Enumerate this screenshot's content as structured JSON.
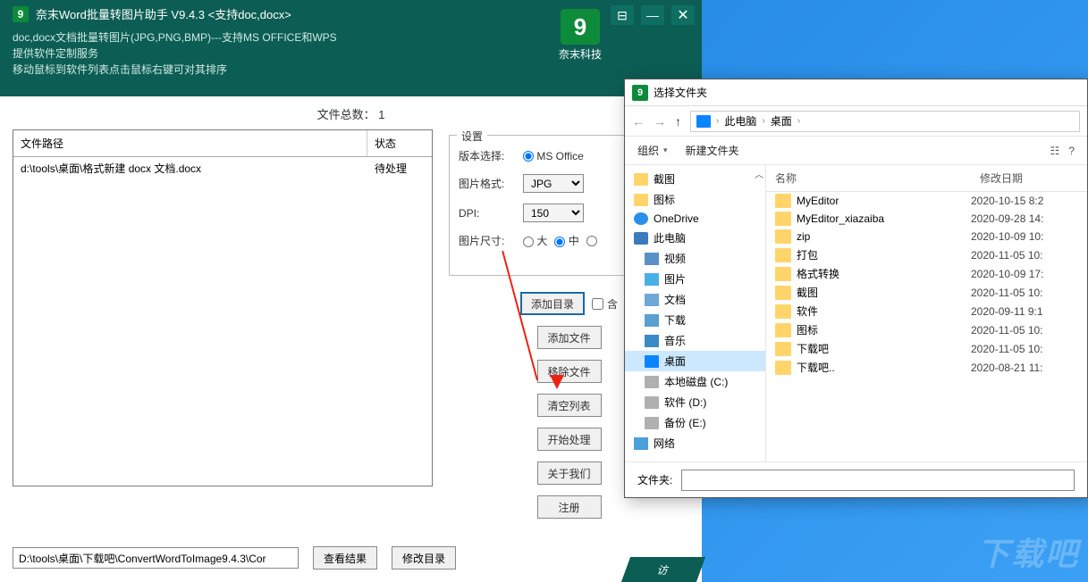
{
  "app": {
    "title": "奈末Word批量转图片助手    V9.4.3   <支持doc,docx>",
    "desc1": "doc,docx文档批量转图片(JPG,PNG,BMP)---支持MS OFFICE和WPS",
    "desc2": "提供软件定制服务",
    "desc3": "移动鼠标到软件列表点击鼠标右键可对其排序",
    "brand": "奈末科技",
    "file_total_label": "文件总数：",
    "file_total": "1",
    "columns": {
      "path": "文件路径",
      "status": "状态"
    },
    "rows": [
      {
        "path": "d:\\tools\\桌面\\格式新建 docx 文档.docx",
        "status": "待处理"
      }
    ],
    "settings": {
      "legend": "设置",
      "version_label": "版本选择:",
      "version_option": "MS Office",
      "format_label": "图片格式:",
      "format_value": "JPG",
      "dpi_label": "DPI:",
      "dpi_value": "150",
      "size_label": "图片尺寸:",
      "size_big": "大",
      "size_mid": "中",
      "include_check": "含"
    },
    "buttons": {
      "add_dir": "添加目录",
      "add_file": "添加文件",
      "remove_file": "移除文件",
      "clear_list": "清空列表",
      "start": "开始处理",
      "about": "关于我们",
      "register": "注册",
      "view_result": "查看结果",
      "change_dir": "修改目录"
    },
    "output_path": "D:\\tools\\桌面\\下载吧\\ConvertWordToImage9.4.3\\Cor",
    "tab_peek": "访"
  },
  "dialog": {
    "title": "选择文件夹",
    "breadcrumb": {
      "pc": "此电脑",
      "desktop": "桌面"
    },
    "toolbar": {
      "organize": "组织",
      "new_folder": "新建文件夹"
    },
    "tree": [
      {
        "label": "截图",
        "icon": "ico-folder",
        "lvl": "l0"
      },
      {
        "label": "图标",
        "icon": "ico-folder",
        "lvl": "l0"
      },
      {
        "label": "OneDrive",
        "icon": "ico-cloud",
        "lvl": "l0"
      },
      {
        "label": "此电脑",
        "icon": "ico-monitor",
        "lvl": "l0"
      },
      {
        "label": "视频",
        "icon": "ico-video",
        "lvl": ""
      },
      {
        "label": "图片",
        "icon": "ico-pic",
        "lvl": ""
      },
      {
        "label": "文档",
        "icon": "ico-doc",
        "lvl": ""
      },
      {
        "label": "下载",
        "icon": "ico-dl",
        "lvl": ""
      },
      {
        "label": "音乐",
        "icon": "ico-music",
        "lvl": ""
      },
      {
        "label": "桌面",
        "icon": "ico-blue",
        "lvl": "",
        "selected": true
      },
      {
        "label": "本地磁盘 (C:)",
        "icon": "ico-drive",
        "lvl": ""
      },
      {
        "label": "软件 (D:)",
        "icon": "ico-drive",
        "lvl": ""
      },
      {
        "label": "备份 (E:)",
        "icon": "ico-drive",
        "lvl": ""
      },
      {
        "label": "网络",
        "icon": "ico-net",
        "lvl": "l0"
      }
    ],
    "list_head": {
      "name": "名称",
      "date": "修改日期"
    },
    "list": [
      {
        "name": "MyEditor",
        "date": "2020-10-15 8:2"
      },
      {
        "name": "MyEditor_xiazaiba",
        "date": "2020-09-28 14:"
      },
      {
        "name": "zip",
        "date": "2020-10-09 10:"
      },
      {
        "name": "打包",
        "date": "2020-11-05 10:"
      },
      {
        "name": "格式转换",
        "date": "2020-10-09 17:"
      },
      {
        "name": "截图",
        "date": "2020-11-05 10:"
      },
      {
        "name": "软件",
        "date": "2020-09-11 9:1"
      },
      {
        "name": "图标",
        "date": "2020-11-05 10:"
      },
      {
        "name": "下载吧",
        "date": "2020-11-05 10:"
      },
      {
        "name": "下载吧..",
        "date": "2020-08-21 11:"
      }
    ],
    "folder_label": "文件夹:"
  },
  "watermark": "下载吧"
}
